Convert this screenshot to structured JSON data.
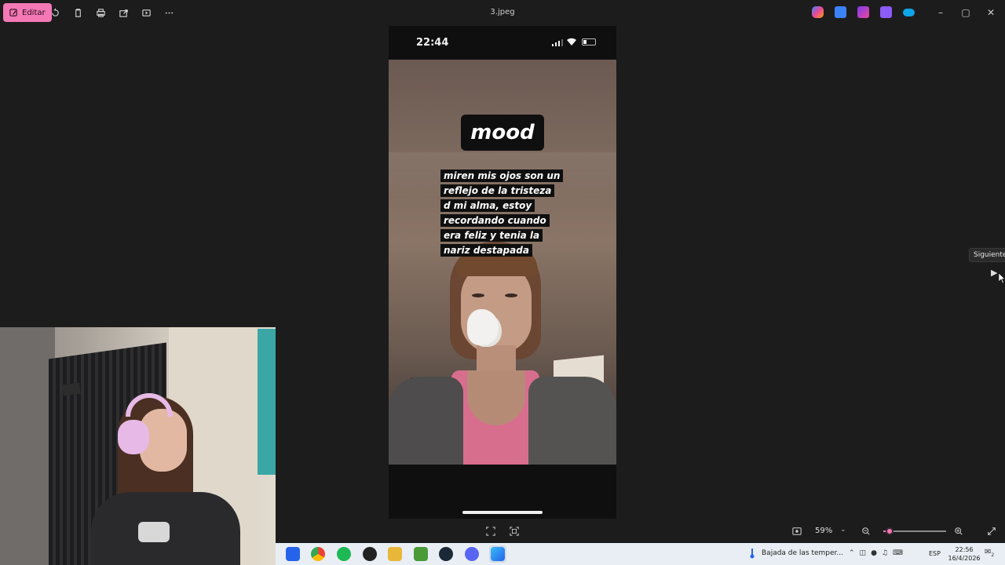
{
  "window": {
    "title": "3.jpeg",
    "edit_label": "Editar"
  },
  "phone": {
    "time": "22:44",
    "sticker_title": "mood",
    "caption_lines": [
      "miren mis ojos son un",
      "reflejo de la tristeza",
      "d mi alma, estoy",
      "recordando cuando",
      "era feliz y tenia la",
      "nariz destapada"
    ]
  },
  "navigation": {
    "next_tooltip": "Siguiente"
  },
  "zoom": {
    "level_label": "59%",
    "level_fraction": 0.1
  },
  "taskbar": {
    "weather_text": "Bajada de las temper...",
    "language": "ESP",
    "clock_time": "22:56",
    "clock_date": "16/4/2026",
    "notification_count": "2"
  },
  "colors": {
    "accent": "#f478b6",
    "background": "#1c1c1c"
  }
}
